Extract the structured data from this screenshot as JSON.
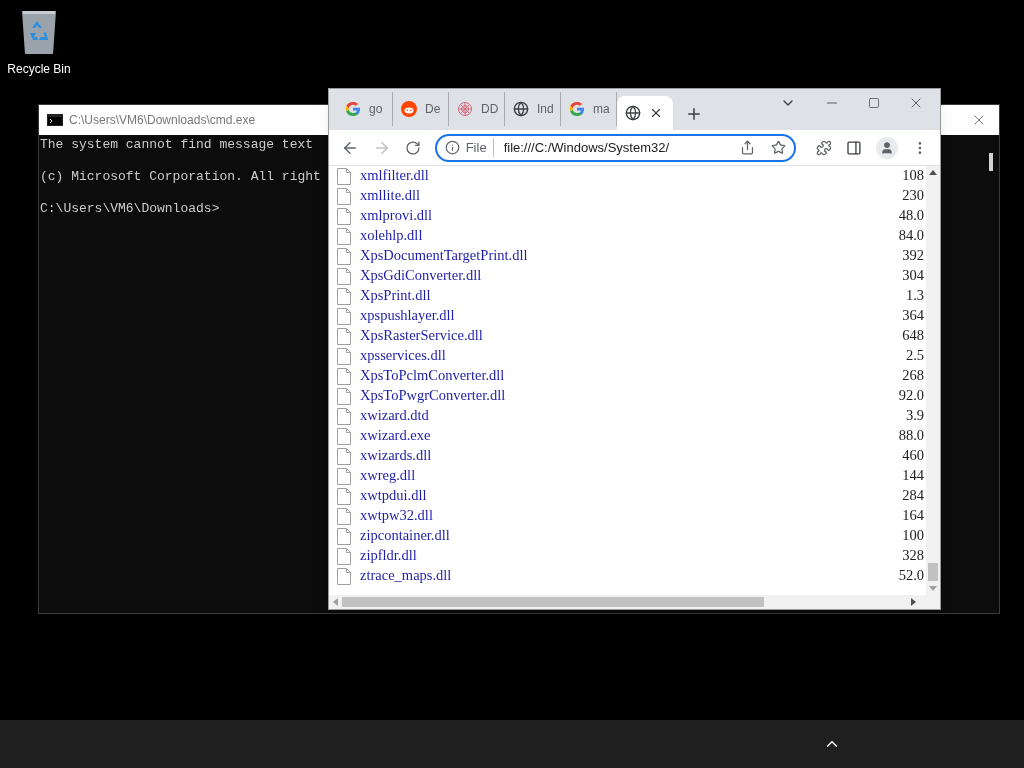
{
  "desktop": {
    "icons": [
      {
        "label": "Recycle Bin"
      }
    ]
  },
  "cmd_window": {
    "title": "C:\\Users\\VM6\\Downloads\\cmd.exe",
    "lines": [
      "The system cannot find message text",
      "(c) Microsoft Corporation. All right",
      "C:\\Users\\VM6\\Downloads>"
    ]
  },
  "browser": {
    "tabs": [
      {
        "kind": "google",
        "title": "go",
        "selected": false
      },
      {
        "kind": "reddit",
        "title": "De",
        "selected": false
      },
      {
        "kind": "flower",
        "title": "DD",
        "selected": false
      },
      {
        "kind": "globe",
        "title": "Ind",
        "selected": false
      },
      {
        "kind": "google",
        "title": "ma",
        "selected": false
      },
      {
        "kind": "globe",
        "selected": true
      }
    ],
    "address": {
      "scheme": "File",
      "url": "file:///C:/Windows/System32/"
    },
    "files": [
      {
        "name": "xmlfilter.dll",
        "size": "108"
      },
      {
        "name": "xmllite.dll",
        "size": "230"
      },
      {
        "name": "xmlprovi.dll",
        "size": "48.0"
      },
      {
        "name": "xolehlp.dll",
        "size": "84.0"
      },
      {
        "name": "XpsDocumentTargetPrint.dll",
        "size": "392"
      },
      {
        "name": "XpsGdiConverter.dll",
        "size": "304"
      },
      {
        "name": "XpsPrint.dll",
        "size": "1.3"
      },
      {
        "name": "xpspushlayer.dll",
        "size": "364"
      },
      {
        "name": "XpsRasterService.dll",
        "size": "648"
      },
      {
        "name": "xpsservices.dll",
        "size": "2.5"
      },
      {
        "name": "XpsToPclmConverter.dll",
        "size": "268"
      },
      {
        "name": "XpsToPwgrConverter.dll",
        "size": "92.0"
      },
      {
        "name": "xwizard.dtd",
        "size": "3.9"
      },
      {
        "name": "xwizard.exe",
        "size": "88.0"
      },
      {
        "name": "xwizards.dll",
        "size": "460"
      },
      {
        "name": "xwreg.dll",
        "size": "144"
      },
      {
        "name": "xwtpdui.dll",
        "size": "284"
      },
      {
        "name": "xwtpw32.dll",
        "size": "164"
      },
      {
        "name": "zipcontainer.dll",
        "size": "100"
      },
      {
        "name": "zipfldr.dll",
        "size": "328"
      },
      {
        "name": "ztrace_maps.dll",
        "size": "52.0"
      }
    ]
  }
}
